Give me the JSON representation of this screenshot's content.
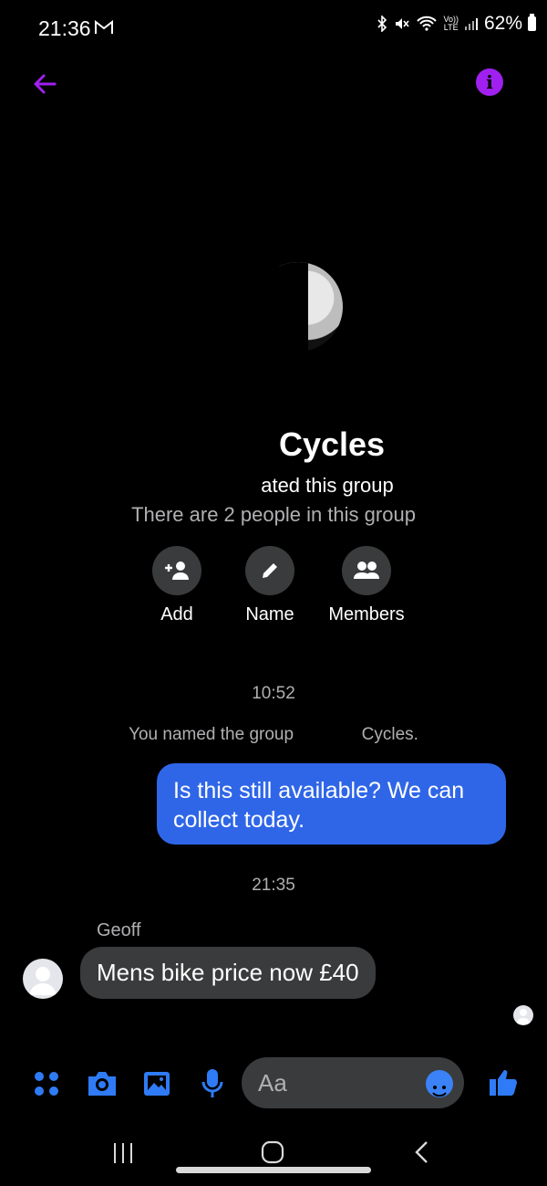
{
  "status_bar": {
    "time": "21:36",
    "battery": "62%",
    "lte": "Vo)) LTE"
  },
  "header": {
    "back_icon": "arrow-left-icon",
    "info_icon": "info-icon",
    "accent": "#a020f0"
  },
  "group": {
    "name": "Cycles",
    "created_text": "ated this group",
    "people_text": "There are 2 people in this group"
  },
  "actions": [
    {
      "label": "Add",
      "icon": "add-person-icon"
    },
    {
      "label": "Name",
      "icon": "pencil-icon"
    },
    {
      "label": "Members",
      "icon": "members-icon"
    }
  ],
  "messages": {
    "time1": "10:52",
    "system_text_a": "You named the group",
    "system_text_b": "Cycles.",
    "outgoing": "Is this still available? We can collect today.",
    "time2": "21:35",
    "sender": "Geoff",
    "incoming": "Mens bike price now £40"
  },
  "composer": {
    "placeholder": "Aa",
    "accent": "#2f7bf5"
  }
}
